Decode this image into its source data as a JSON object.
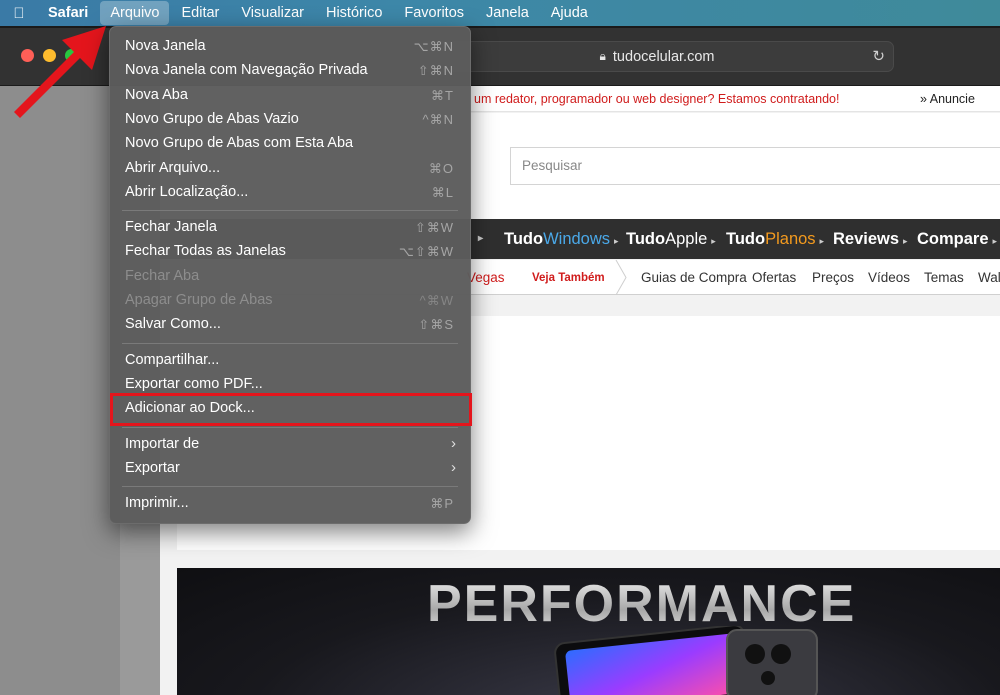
{
  "menubar": {
    "apple_icon": "apple-icon",
    "items": [
      "Safari",
      "Arquivo",
      "Editar",
      "Visualizar",
      "Histórico",
      "Favoritos",
      "Janela",
      "Ajuda"
    ],
    "active": "Arquivo"
  },
  "browser": {
    "url": "tudocelular.com"
  },
  "page": {
    "recruit_text": "um redator, programador ou web designer? Estamos contratando!",
    "anuncie": "» Anuncie",
    "search_placeholder": "Pesquisar",
    "nav": [
      {
        "a": "Tudo",
        "b": "Windows",
        "b_color": "#4aa8e8"
      },
      {
        "a": "Tudo",
        "b": "Apple",
        "b_color": "#ffffff"
      },
      {
        "a": "Tudo",
        "b": "Planos",
        "b_color": "#f39a1e"
      },
      {
        "a": "Reviews",
        "b": "",
        "b_color": "#ffffff"
      },
      {
        "a": "Compare",
        "b": "",
        "b_color": "#ffffff"
      }
    ],
    "subnav_red": "Vegas",
    "veja_tambem": "Veja Também",
    "subnav": [
      "Guias de Compra",
      "Ofertas",
      "Preços",
      "Vídeos",
      "Temas",
      "Wall"
    ],
    "banner_text": "PERFORMANCE"
  },
  "file_menu": {
    "groups": [
      [
        {
          "label": "Nova Janela",
          "shortcut": "⌥⌘N",
          "enabled": true
        },
        {
          "label": "Nova Janela com Navegação Privada",
          "shortcut": "⇧⌘N",
          "enabled": true
        },
        {
          "label": "Nova Aba",
          "shortcut": "⌘T",
          "enabled": true
        },
        {
          "label": "Novo Grupo de Abas Vazio",
          "shortcut": "^⌘N",
          "enabled": true
        },
        {
          "label": "Novo Grupo de Abas com Esta Aba",
          "shortcut": "",
          "enabled": true
        },
        {
          "label": "Abrir Arquivo...",
          "shortcut": "⌘O",
          "enabled": true
        },
        {
          "label": "Abrir Localização...",
          "shortcut": "⌘L",
          "enabled": true
        }
      ],
      [
        {
          "label": "Fechar Janela",
          "shortcut": "⇧⌘W",
          "enabled": true
        },
        {
          "label": "Fechar Todas as Janelas",
          "shortcut": "⌥⇧⌘W",
          "enabled": true
        },
        {
          "label": "Fechar Aba",
          "shortcut": "",
          "enabled": false
        },
        {
          "label": "Apagar Grupo de Abas",
          "shortcut": "^⌘W",
          "enabled": false
        },
        {
          "label": "Salvar Como...",
          "shortcut": "⇧⌘S",
          "enabled": true
        }
      ],
      [
        {
          "label": "Compartilhar...",
          "shortcut": "",
          "enabled": true
        },
        {
          "label": "Exportar como PDF...",
          "shortcut": "",
          "enabled": true
        },
        {
          "label": "Adicionar ao Dock...",
          "shortcut": "",
          "enabled": true,
          "highlighted": true
        }
      ],
      [
        {
          "label": "Importar de",
          "shortcut": "",
          "enabled": true,
          "submenu": true
        },
        {
          "label": "Exportar",
          "shortcut": "",
          "enabled": true,
          "submenu": true
        }
      ],
      [
        {
          "label": "Imprimir...",
          "shortcut": "⌘P",
          "enabled": true
        }
      ]
    ]
  },
  "annotation": {
    "highlight_color": "#e4151c",
    "arrow_color": "#e4151c"
  }
}
